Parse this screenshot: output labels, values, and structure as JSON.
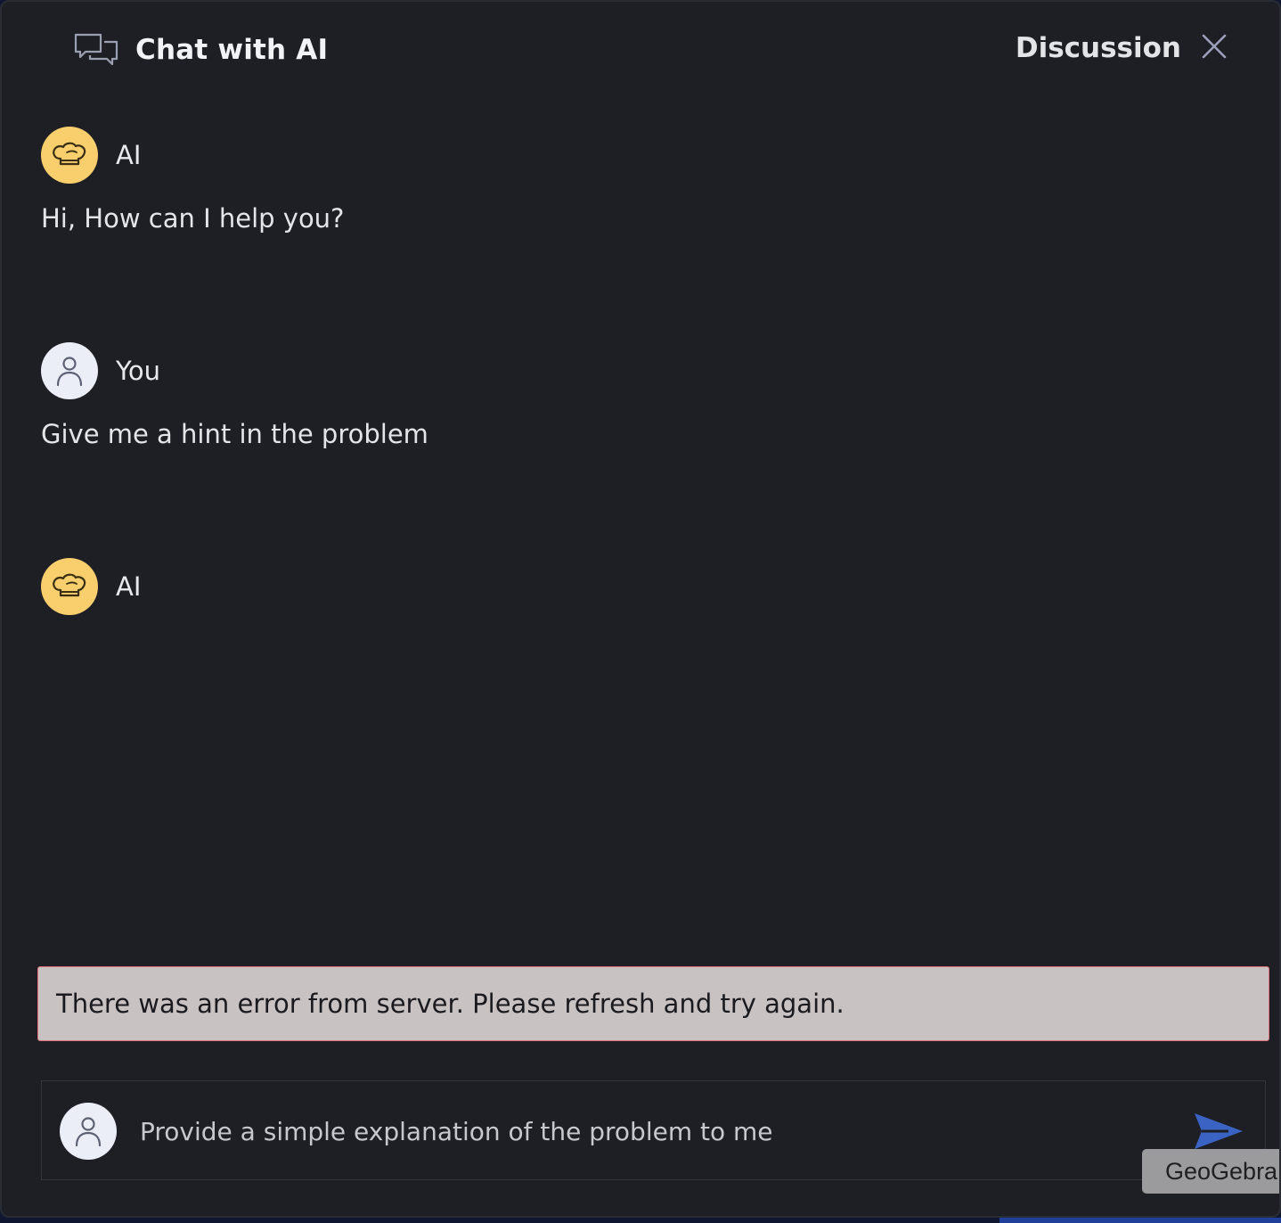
{
  "header": {
    "title": "Chat with AI",
    "tab_label": "Discussion"
  },
  "messages": [
    {
      "sender": "AI",
      "role": "ai",
      "text": "Hi, How can I help you?"
    },
    {
      "sender": "You",
      "role": "user",
      "text": "Give me a hint in the problem"
    },
    {
      "sender": "AI",
      "role": "ai",
      "text": ""
    }
  ],
  "error": {
    "text": "There was an error from server. Please refresh and try again."
  },
  "input": {
    "value": "Provide a simple explanation of the problem to me"
  },
  "badge": {
    "text": "GeoGebra"
  },
  "colors": {
    "panel_bg": "#1e1f24",
    "ai_avatar": "#f8cf6c",
    "user_avatar": "#eceef7",
    "send_icon": "#3a63c4",
    "error_bg": "#c9c2c2",
    "error_border": "#e1707a"
  },
  "icons": {
    "header": "chat-bubbles-icon",
    "close": "close-icon",
    "ai_avatar": "chef-hat-icon",
    "user_avatar": "person-icon",
    "send": "send-icon"
  }
}
